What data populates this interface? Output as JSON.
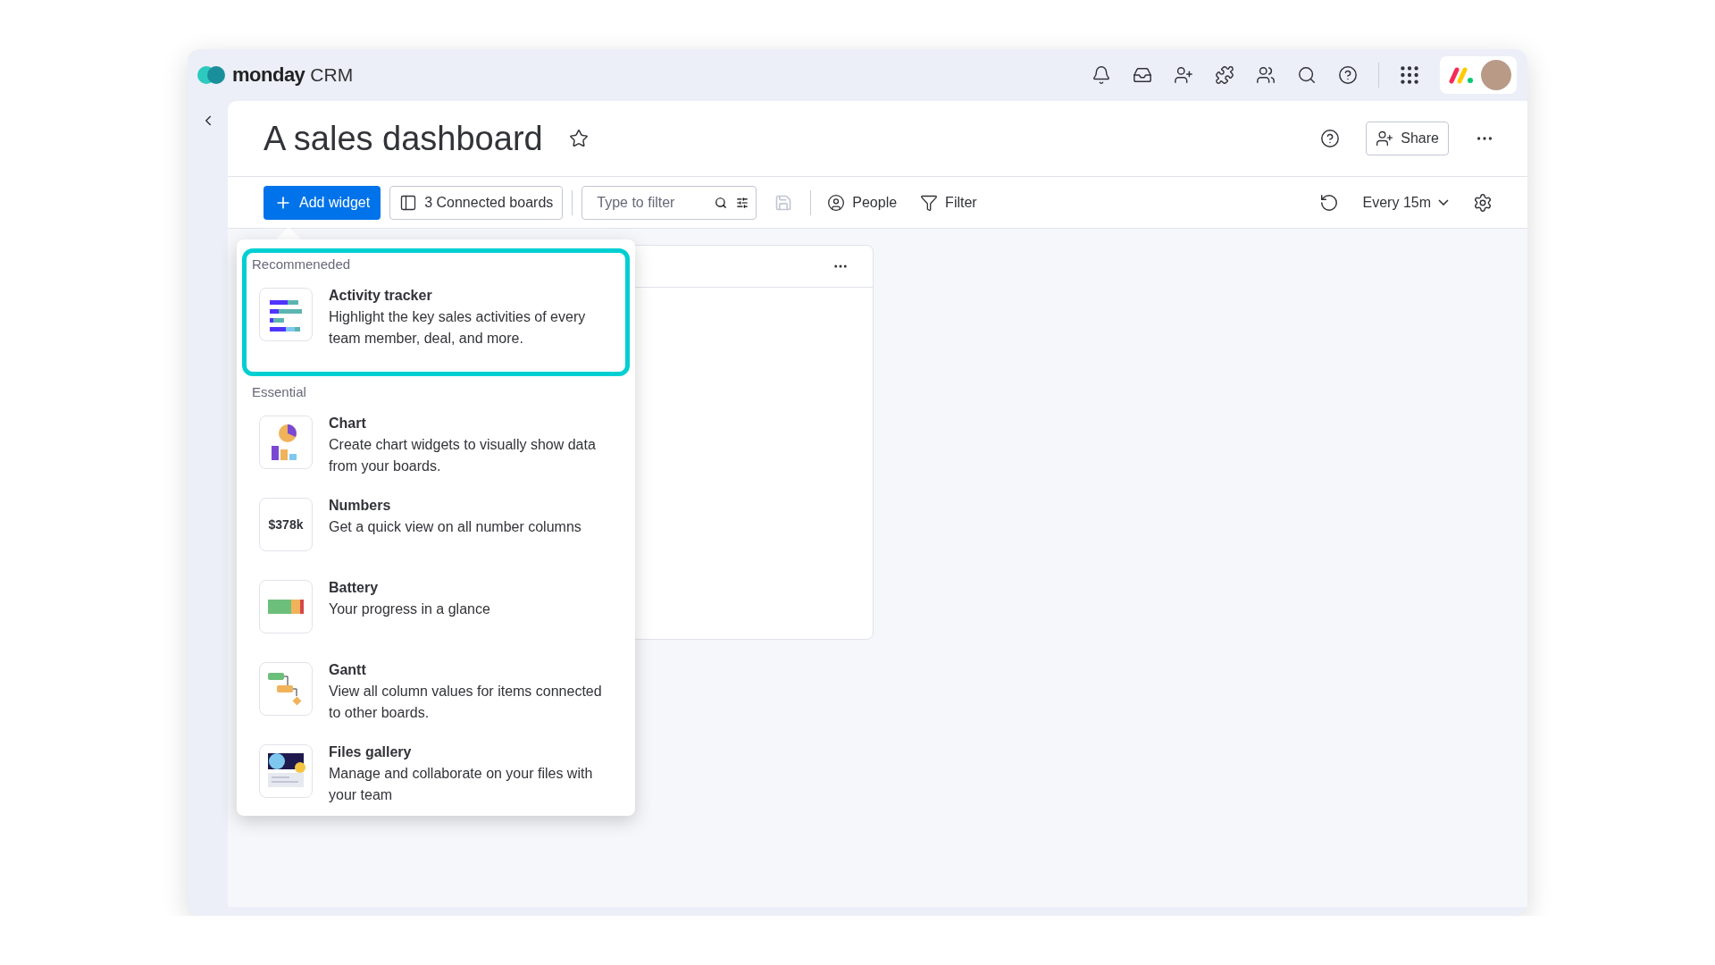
{
  "top_bar": {
    "brand": "monday",
    "product": "CRM"
  },
  "page": {
    "title": "A sales dashboard",
    "share": "Share"
  },
  "toolbar": {
    "add_widget": "Add widget",
    "connected_boards": "3 Connected boards",
    "filter_field": {
      "placeholder": "Type to filter"
    },
    "people": "People",
    "filter": "Filter",
    "refresh": "Every 15m"
  },
  "widget_menu": {
    "sections": [
      {
        "title": "Recommeneded",
        "highlighted": true,
        "items": [
          {
            "kind": "activity",
            "name": "Activity tracker",
            "description": "Highlight the key sales activities of every team member, deal, and more."
          }
        ]
      },
      {
        "title": "Essential",
        "highlighted": false,
        "items": [
          {
            "kind": "chart",
            "name": "Chart",
            "description": "Create chart widgets to visually show data from your boards."
          },
          {
            "kind": "numbers",
            "name": "Numbers",
            "description": "Get a quick view on all number columns",
            "icon_text": "$378k"
          },
          {
            "kind": "battery",
            "name": "Battery",
            "description": "Your progress in a glance"
          },
          {
            "kind": "gantt",
            "name": "Gantt",
            "description": "View all column values for items connected to other boards."
          },
          {
            "kind": "files",
            "name": "Files gallery",
            "description": "Manage and collaborate on your files with your team"
          }
        ]
      }
    ]
  }
}
